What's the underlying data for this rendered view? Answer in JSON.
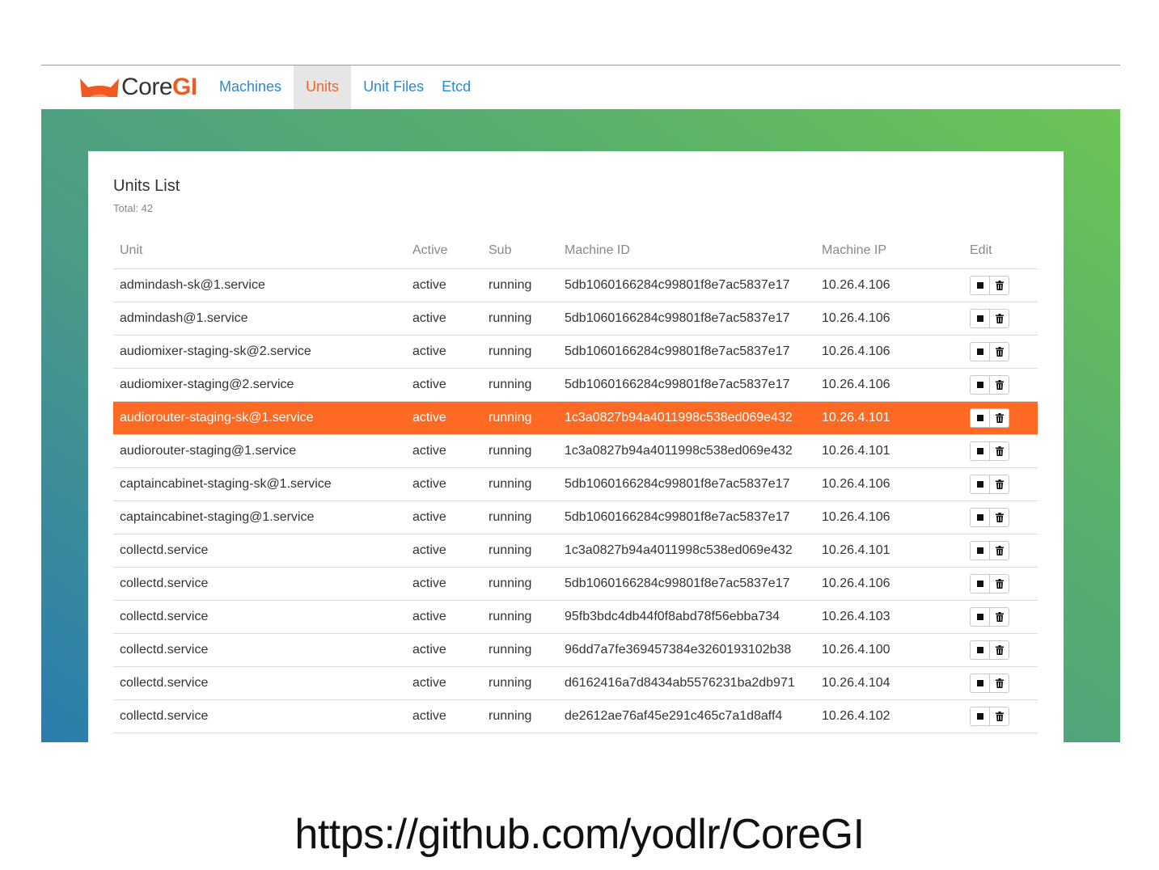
{
  "brand": {
    "core": "Core",
    "gi": "GI",
    "logo_icon": "cat-ears-logo"
  },
  "nav": {
    "items": [
      {
        "label": "Machines",
        "active": false
      },
      {
        "label": "Units",
        "active": true
      },
      {
        "label": "Unit Files",
        "active": false
      },
      {
        "label": "Etcd",
        "active": false
      }
    ]
  },
  "panel": {
    "title": "Units List",
    "subtitle": "Total: 42"
  },
  "table": {
    "headers": [
      "Unit",
      "Active",
      "Sub",
      "Machine ID",
      "Machine IP",
      "Edit"
    ],
    "rows": [
      [
        "admindash-sk@1.service",
        "active",
        "running",
        "5db1060166284c99801f8e7ac5837e17",
        "10.26.4.106"
      ],
      [
        "admindash@1.service",
        "active",
        "running",
        "5db1060166284c99801f8e7ac5837e17",
        "10.26.4.106"
      ],
      [
        "audiomixer-staging-sk@2.service",
        "active",
        "running",
        "5db1060166284c99801f8e7ac5837e17",
        "10.26.4.106"
      ],
      [
        "audiomixer-staging@2.service",
        "active",
        "running",
        "5db1060166284c99801f8e7ac5837e17",
        "10.26.4.106"
      ],
      [
        "audiorouter-staging-sk@1.service",
        "active",
        "running",
        "1c3a0827b94a4011998c538ed069e432",
        "10.26.4.101"
      ],
      [
        "audiorouter-staging@1.service",
        "active",
        "running",
        "1c3a0827b94a4011998c538ed069e432",
        "10.26.4.101"
      ],
      [
        "captaincabinet-staging-sk@1.service",
        "active",
        "running",
        "5db1060166284c99801f8e7ac5837e17",
        "10.26.4.106"
      ],
      [
        "captaincabinet-staging@1.service",
        "active",
        "running",
        "5db1060166284c99801f8e7ac5837e17",
        "10.26.4.106"
      ],
      [
        "collectd.service",
        "active",
        "running",
        "1c3a0827b94a4011998c538ed069e432",
        "10.26.4.101"
      ],
      [
        "collectd.service",
        "active",
        "running",
        "5db1060166284c99801f8e7ac5837e17",
        "10.26.4.106"
      ],
      [
        "collectd.service",
        "active",
        "running",
        "95fb3bdc4db44f0f8abd78f56ebba734",
        "10.26.4.103"
      ],
      [
        "collectd.service",
        "active",
        "running",
        "96dd7a7fe369457384e3260193102b38",
        "10.26.4.100"
      ],
      [
        "collectd.service",
        "active",
        "running",
        "d6162416a7d8434ab5576231ba2db971",
        "10.26.4.104"
      ],
      [
        "collectd.service",
        "active",
        "running",
        "de2612ae76af45e291c465c7a1d8aff4",
        "10.26.4.102"
      ]
    ],
    "highlighted_row": 4,
    "edit_icons": [
      "stop-icon",
      "trash-icon"
    ]
  },
  "colors": {
    "accent": "#f05a22",
    "highlight": "#fe6a23",
    "link": "#2a8ad2"
  },
  "footer": {
    "url": "https://github.com/yodlr/CoreGI"
  }
}
